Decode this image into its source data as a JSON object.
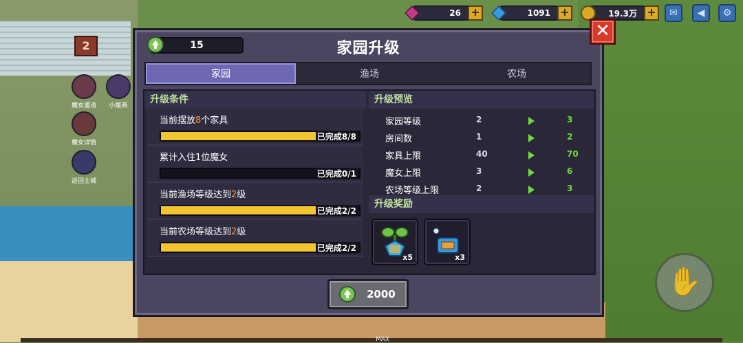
{
  "hud": {
    "gem_pink": "26",
    "gem_blue": "1091",
    "gold": "19.3万",
    "plus": "+"
  },
  "sidebar": {
    "house_badge": "2",
    "items": [
      {
        "label": "魔女邀请"
      },
      {
        "label": "小屋商"
      },
      {
        "label": "魔女详情"
      },
      {
        "label": "返回主城"
      }
    ]
  },
  "dialog": {
    "title": "家园升级",
    "level": "15",
    "close": "✕",
    "tabs": [
      {
        "label": "家园",
        "active": true
      },
      {
        "label": "渔场",
        "active": false
      },
      {
        "label": "农场",
        "active": false
      }
    ],
    "conditions_header": "升级条件",
    "conditions": [
      {
        "pre": "当前摆放",
        "num": "8",
        "post": "个家具",
        "status": "已完成8/8",
        "progress": 1.0
      },
      {
        "pre": "累计入住1位魔女",
        "num": "",
        "post": "",
        "status": "已完成0/1",
        "progress": 0.0
      },
      {
        "pre": "当前渔场等级达到",
        "num": "2",
        "post": "级",
        "status": "已完成2/2",
        "progress": 1.0
      },
      {
        "pre": "当前农场等级达到",
        "num": "2",
        "post": "级",
        "status": "已完成2/2",
        "progress": 1.0
      }
    ],
    "preview_header": "升级预览",
    "preview": [
      {
        "label": "家园等级",
        "from": "2",
        "to": "3"
      },
      {
        "label": "房间数",
        "from": "1",
        "to": "2"
      },
      {
        "label": "家具上限",
        "from": "40",
        "to": "70"
      },
      {
        "label": "魔女上限",
        "from": "3",
        "to": "6"
      },
      {
        "label": "农场等级上限",
        "from": "2",
        "to": "3"
      }
    ],
    "rewards_header": "升级奖励",
    "rewards": [
      {
        "icon": "sprout-crystal-icon",
        "count": "x5"
      },
      {
        "icon": "blue-chest-icon",
        "count": "x3"
      }
    ],
    "cost": "2000"
  },
  "footer": {
    "max_label": "MAX"
  },
  "colors": {
    "accent_yellow": "#f2c531",
    "highlight_orange": "#ff9a2a",
    "preview_green": "#6fdc3a",
    "tab_active": "#6e68b4"
  }
}
